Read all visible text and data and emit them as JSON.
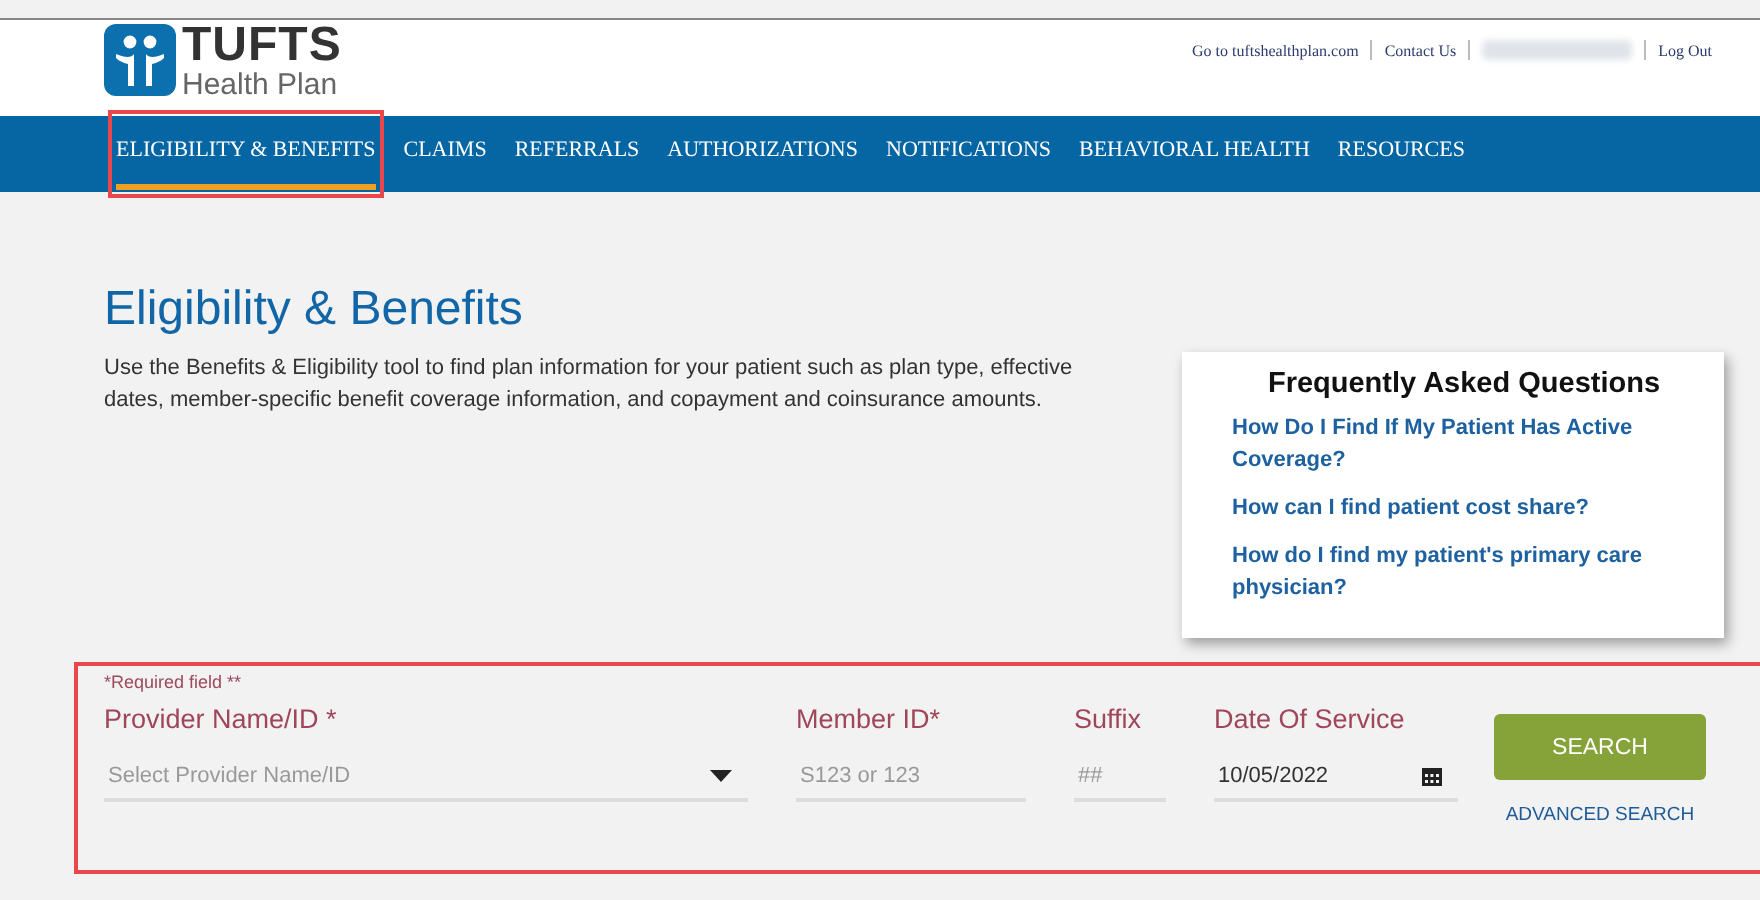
{
  "header": {
    "logo": {
      "name": "TUFTS",
      "subtitle": "Health Plan"
    },
    "links": [
      {
        "kind": "link",
        "label": "Go to tuftshealthplan.com"
      },
      {
        "kind": "link",
        "label": "Contact Us"
      },
      {
        "kind": "redacted"
      },
      {
        "kind": "link",
        "label": "Log Out"
      }
    ]
  },
  "nav": [
    {
      "label": "ELIGIBILITY & BENEFITS",
      "selected": true
    },
    {
      "label": "CLAIMS",
      "selected": false
    },
    {
      "label": "REFERRALS",
      "selected": false
    },
    {
      "label": "AUTHORIZATIONS",
      "selected": false
    },
    {
      "label": "NOTIFICATIONS",
      "selected": false
    },
    {
      "label": "BEHAVIORAL HEALTH",
      "selected": false
    },
    {
      "label": "RESOURCES",
      "selected": false
    }
  ],
  "page": {
    "title": "Eligibility & Benefits",
    "description": "Use the Benefits & Eligibility tool to find plan information for your patient such as plan type, effective dates, member-specific benefit coverage information, and copayment and coinsurance amounts."
  },
  "faq": {
    "title": "Frequently Asked Questions",
    "questions": [
      "How Do I Find If My Patient Has Active Coverage?",
      "How can I find patient cost share?",
      "How do I find my patient's primary care physician?"
    ]
  },
  "form": {
    "required_note": "*Required field **",
    "fields": [
      {
        "kind": "select",
        "label": "Provider Name/ID *",
        "placeholder": "Select Provider Name/ID"
      },
      {
        "kind": "text",
        "label": "Member ID*",
        "placeholder": "S123 or 123"
      },
      {
        "kind": "text",
        "label": "Suffix",
        "placeholder": "##"
      },
      {
        "kind": "date",
        "label": "Date Of Service",
        "value": "10/05/2022"
      }
    ],
    "search_button": "SEARCH",
    "advanced_link": "ADVANCED SEARCH"
  }
}
